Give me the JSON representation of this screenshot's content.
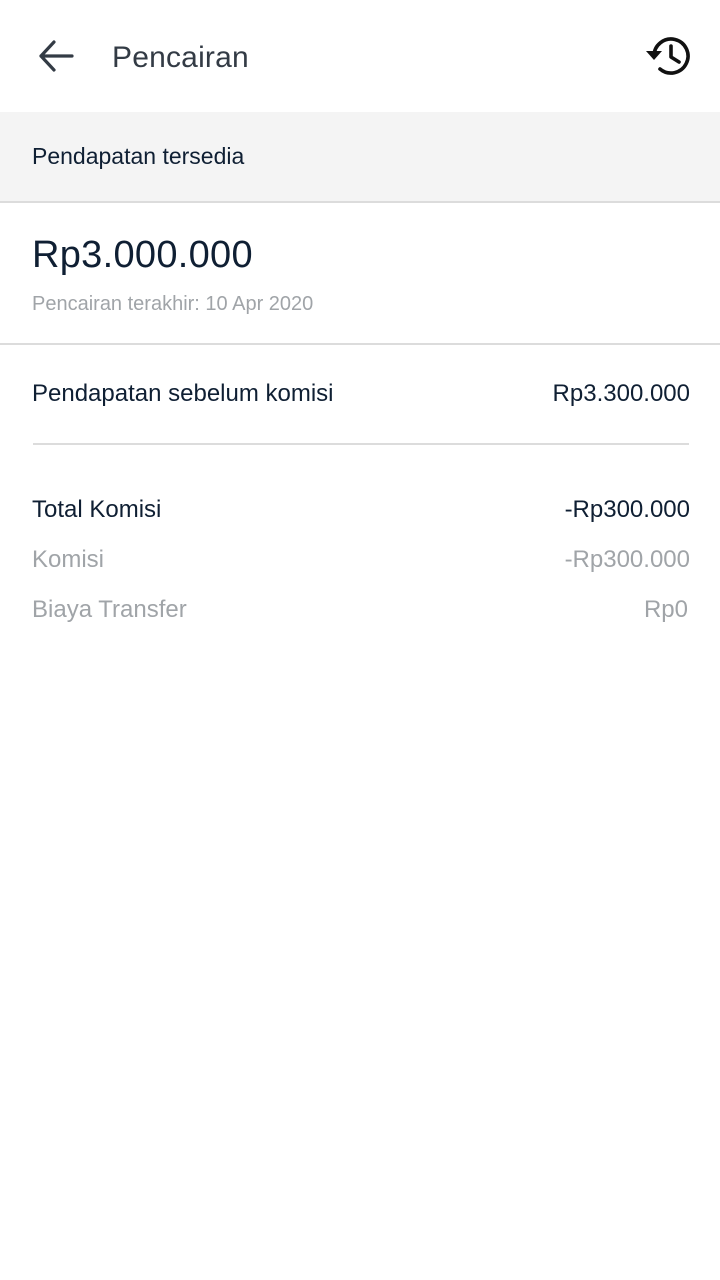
{
  "header": {
    "title": "Pencairan",
    "back_icon": "arrow-left-icon",
    "history_icon": "history-icon"
  },
  "available": {
    "section_label": "Pendapatan tersedia",
    "amount": "Rp3.000.000",
    "last_withdrawal": "Pencairan terakhir: 10 Apr 2020"
  },
  "gross": {
    "label": "Pendapatan sebelum komisi",
    "value": "Rp3.300.000"
  },
  "commission": {
    "total_label": "Total Komisi",
    "total_value": "-Rp300.000",
    "commission_label": "Komisi",
    "commission_value": "-Rp300.000",
    "transfer_label": "Biaya Transfer",
    "transfer_value": "Rp0"
  },
  "colors": {
    "text_primary": "#0f1f33",
    "text_muted": "#a0a4a8",
    "section_bg": "#f4f4f4",
    "divider": "#dcdcdc"
  }
}
